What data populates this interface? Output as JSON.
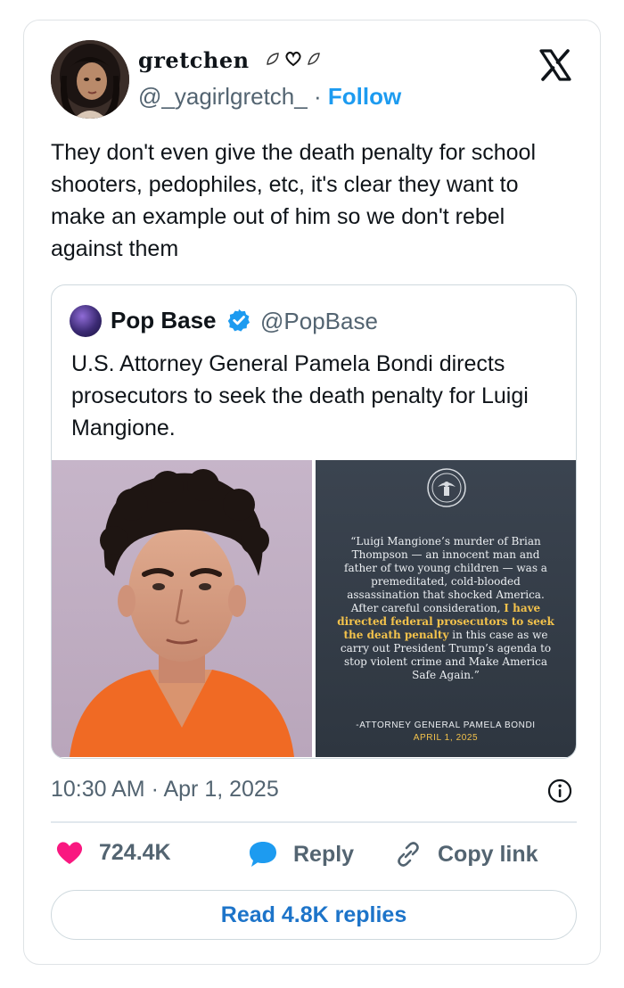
{
  "author": {
    "display_name": "gretchen",
    "handle": "@_yagirlgretch_",
    "separator": "·",
    "follow_label": "Follow"
  },
  "tweet": {
    "text": "They don't even give the death penalty for school shooters, pedophiles, etc, it's clear they want to make an example out of him so we don't rebel against them",
    "timestamp": "10:30 AM · Apr 1, 2025"
  },
  "quoted_tweet": {
    "author_name": "Pop Base",
    "author_handle": "@PopBase",
    "text": "U.S. Attorney General Pamela Bondi directs prosecutors to seek the death penalty for Luigi Mangione.",
    "statement": {
      "quote_part1": "“Luigi Mangione’s murder of Brian Thompson — an innocent man and father of two young children — was a premeditated, cold-blooded assassination that shocked America. After careful consideration, ",
      "quote_highlight": "I have directed federal prosecutors to seek the death penalty",
      "quote_part2": " in this case as we carry out President Trump’s agenda to stop violent crime and Make America Safe Again.”",
      "attribution": "-ATTORNEY GENERAL PAMELA BONDI",
      "date": "APRIL 1, 2025"
    }
  },
  "actions": {
    "likes": "724.4K",
    "reply_label": "Reply",
    "copy_link_label": "Copy link",
    "read_replies_label": "Read 4.8K replies"
  },
  "colors": {
    "accent_blue": "#1d9bf0",
    "like_pink": "#f91880",
    "highlight_gold": "#f3c24b"
  }
}
